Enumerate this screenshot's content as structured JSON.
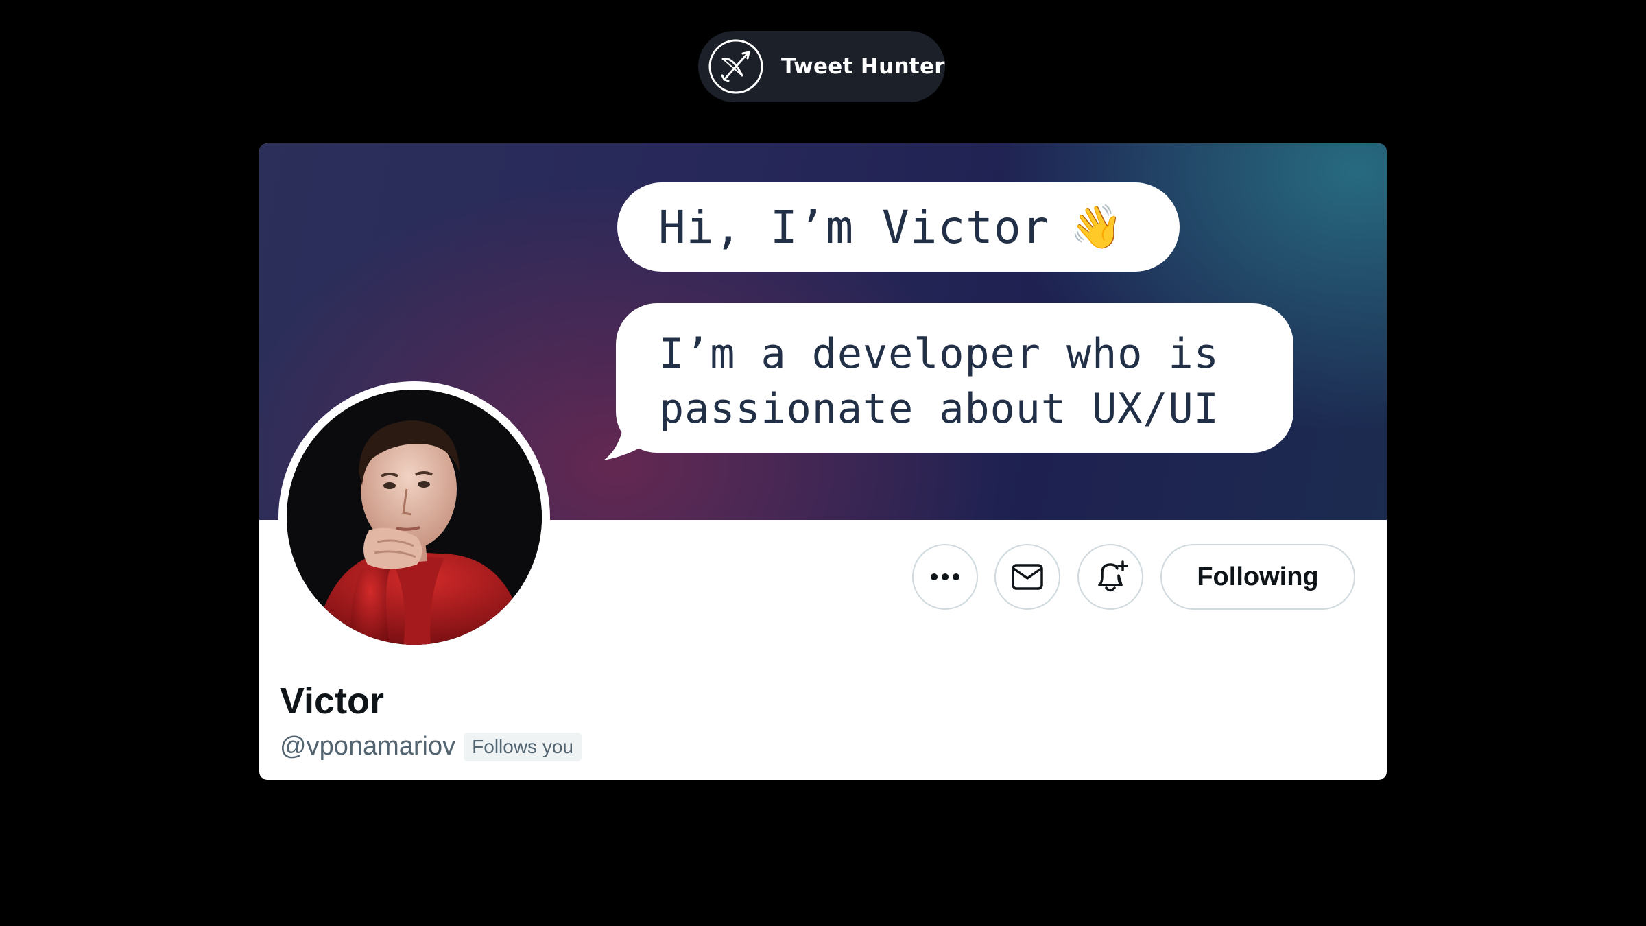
{
  "brand": {
    "name": "Tweet Hunter",
    "icon": "bow-and-arrow-icon"
  },
  "profile": {
    "banner": {
      "greeting": "Hi, I’m Victor",
      "greeting_emoji": "👋",
      "tagline_line1": "I’m a developer who is",
      "tagline_line2": "passionate about UX/UI"
    },
    "display_name": "Victor",
    "handle": "@vponamariov",
    "follows_you_label": "Follows you",
    "actions": {
      "more_icon": "more-dots-icon",
      "message_icon": "envelope-icon",
      "notify_icon": "bell-plus-icon",
      "following_label": "Following"
    }
  },
  "colors": {
    "page_background": "#000000",
    "pill_background": "#1b2029",
    "text_primary": "#0f1419",
    "text_secondary": "#536471",
    "button_border": "#cfd9de"
  }
}
